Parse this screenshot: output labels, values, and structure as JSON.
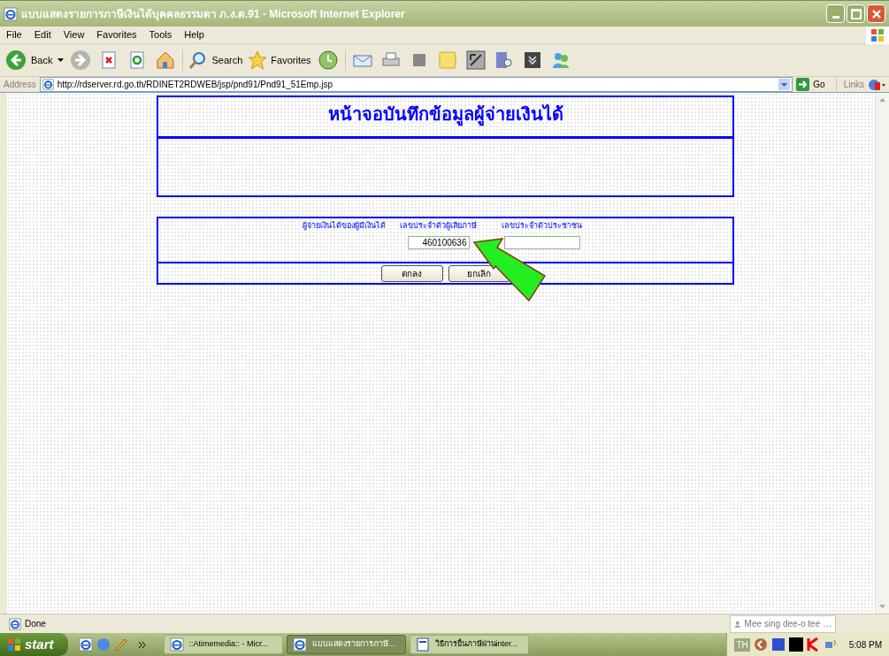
{
  "window": {
    "title": "แบบแสดงรายการภาษีเงินได้บุคคลธรรมดา ภ.ง.ด.91 - Microsoft Internet Explorer"
  },
  "menu": [
    "File",
    "Edit",
    "View",
    "Favorites",
    "Tools",
    "Help"
  ],
  "toolbar": {
    "back": "Back",
    "search": "Search",
    "favorites": "Favorites"
  },
  "address_bar": {
    "label": "Address",
    "url": "http://rdserver.rd.go.th/RDINET2RDWEB/jsp/pnd91/Pnd91_51Emp.jsp",
    "go": "Go",
    "links": "Links"
  },
  "page": {
    "heading": "หน้าจอบันทึกข้อมูลผู้จ่ายเงินได้",
    "form": {
      "row_label": "ผู้จ่ายเงินได้ของผู้มีเงินได้",
      "fields": [
        {
          "label": "เลขประจำตัวผู้เสียภาษี",
          "value": "460100636"
        },
        {
          "label": "เลขประจำตัวประชาชน"
        }
      ]
    },
    "buttons": [
      "ตกลง",
      "ยกเลิก"
    ]
  },
  "status_bar": {
    "text": "Done",
    "user": "Mee sing dee-o tee …"
  },
  "taskbar": {
    "start": "start",
    "tasks": [
      {
        "label": "::Atimemedia:: - Micr...",
        "selected": false,
        "kind": "ie"
      },
      {
        "label": "แบบแสดงรายการภาษี...",
        "selected": true,
        "kind": "ie"
      },
      {
        "label": "วิธีการยื่นภาษีผ่านinter...",
        "selected": false,
        "kind": "word"
      }
    ],
    "language": "TH",
    "clock": "5:08 PM"
  }
}
